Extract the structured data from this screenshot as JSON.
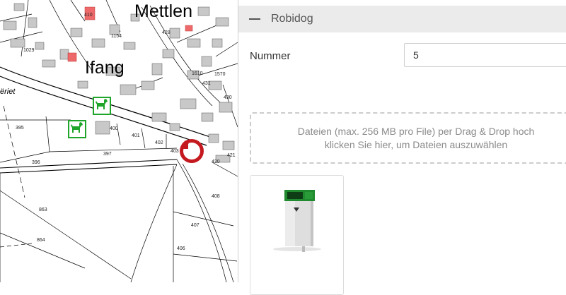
{
  "map": {
    "place_labels": {
      "mettlen": "Mettlen",
      "ifang": "Ifang",
      "riet": "ëriet"
    },
    "parcel_numbers": [
      "410",
      "428",
      "1154",
      "1029",
      "1610",
      "1570",
      "431",
      "430",
      "395",
      "400",
      "401",
      "402",
      "403",
      "397",
      "396",
      "421",
      "420",
      "408",
      "863",
      "407",
      "864",
      "406"
    ],
    "markers": {
      "dog_icon": "dog-icon",
      "poi_icon": "dog-waste-bin-icon"
    },
    "colors": {
      "dog_marker": "#1ea52a",
      "poi_marker": "#c4191f",
      "highlight_building": "#ee6a6a"
    }
  },
  "panel": {
    "section_title": "Robidog",
    "fields": {
      "nummer_label": "Nummer",
      "nummer_value": "5"
    },
    "dropzone": {
      "line1": "Dateien (max. 256 MB pro File) per Drag & Drop hoch",
      "line2": "klicken Sie hier, um Dateien auszuwählen"
    },
    "file_thumbnail": {
      "subject": "robidog-dispenser-image",
      "colors": {
        "top": "#1f8a2e",
        "body": "#dcdcdc"
      }
    }
  }
}
